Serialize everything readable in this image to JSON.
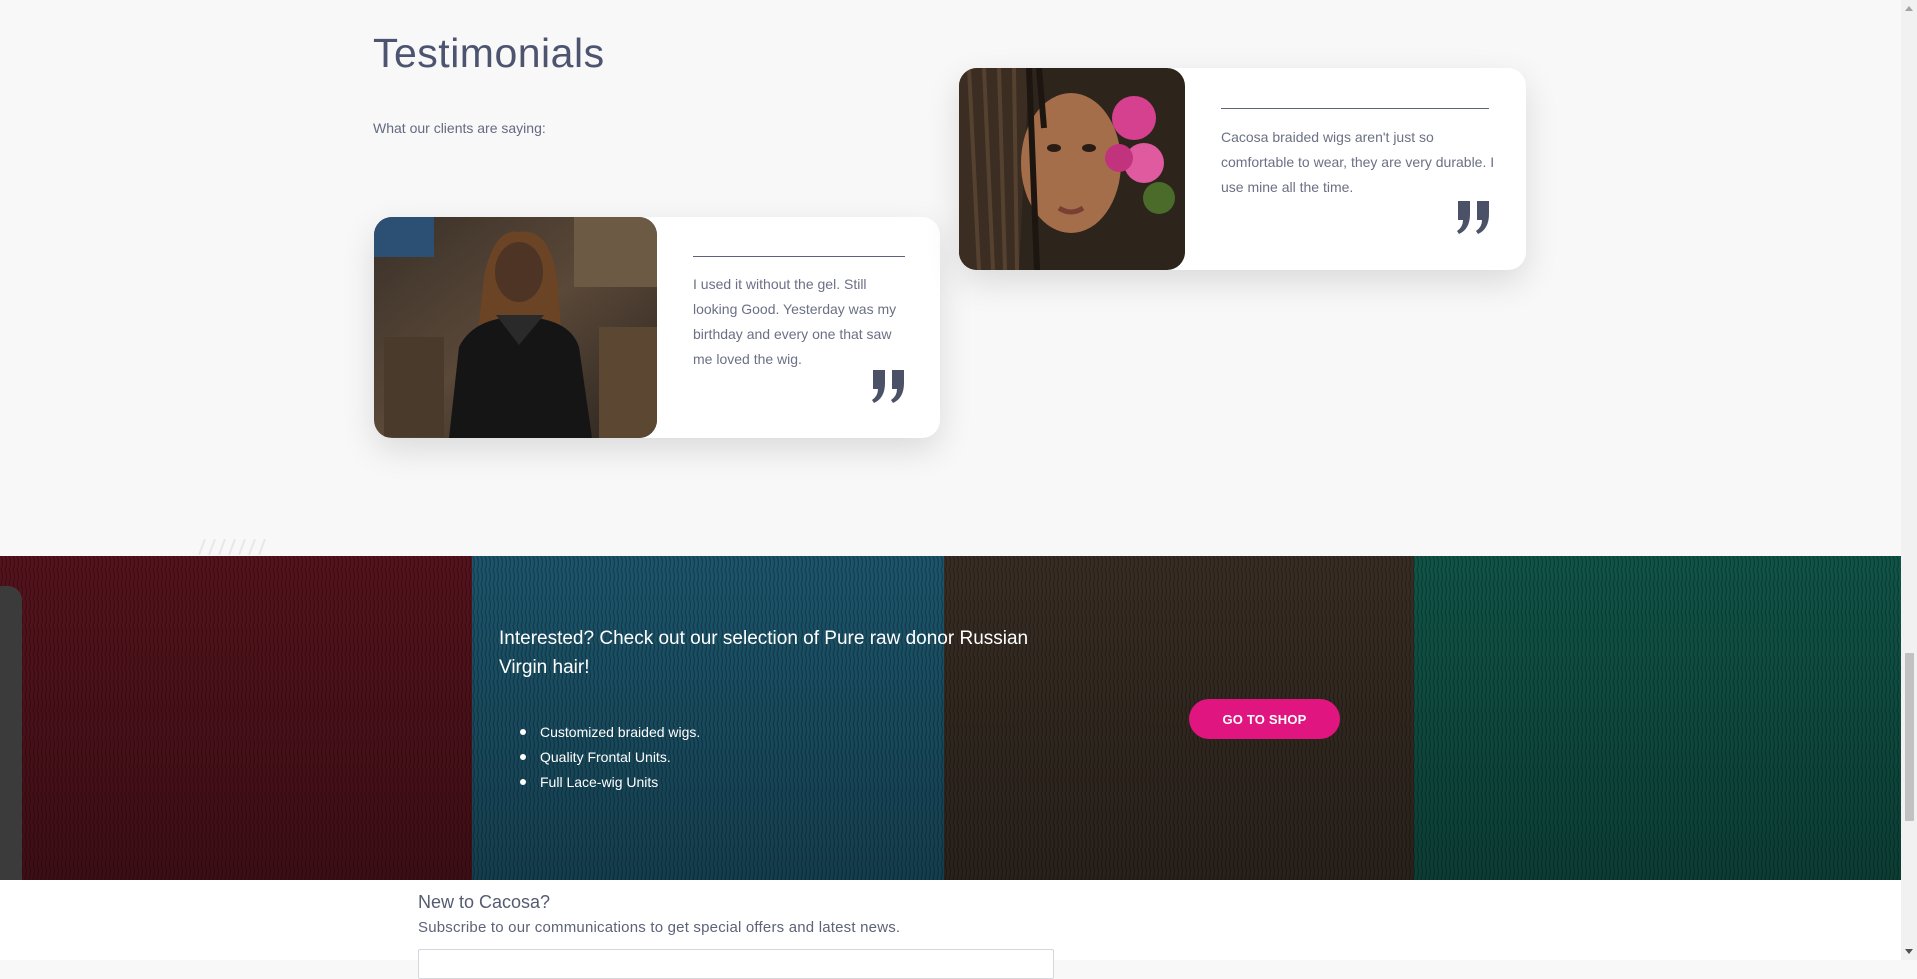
{
  "testimonials": {
    "title": "Testimonials",
    "subtitle": "What our clients are saying:",
    "items": [
      {
        "quote": "I used it without the gel. Still looking Good. Yesterday was my birthday and every one that saw me loved the wig.",
        "icon": "quote-close-icon"
      },
      {
        "quote": "Cacosa braided wigs aren't just so comfortable to wear, they are very durable. I use mine all the time.",
        "icon": "quote-close-icon"
      }
    ]
  },
  "banner": {
    "title": "Interested? Check out our selection of Pure raw donor Russian Virgin hair!",
    "features": [
      "Customized braided wigs.",
      "Quality Frontal Units.",
      "Full Lace-wig Units"
    ],
    "button_label": "GO TO SHOP",
    "button_color": "#e0157f",
    "background_colors": [
      "#5e1520",
      "#1f5f78",
      "#3e3228",
      "#125e50"
    ]
  },
  "newsletter": {
    "title": "New to Cacosa?",
    "subtitle": "Subscribe to our communications to get special offers and latest news."
  }
}
